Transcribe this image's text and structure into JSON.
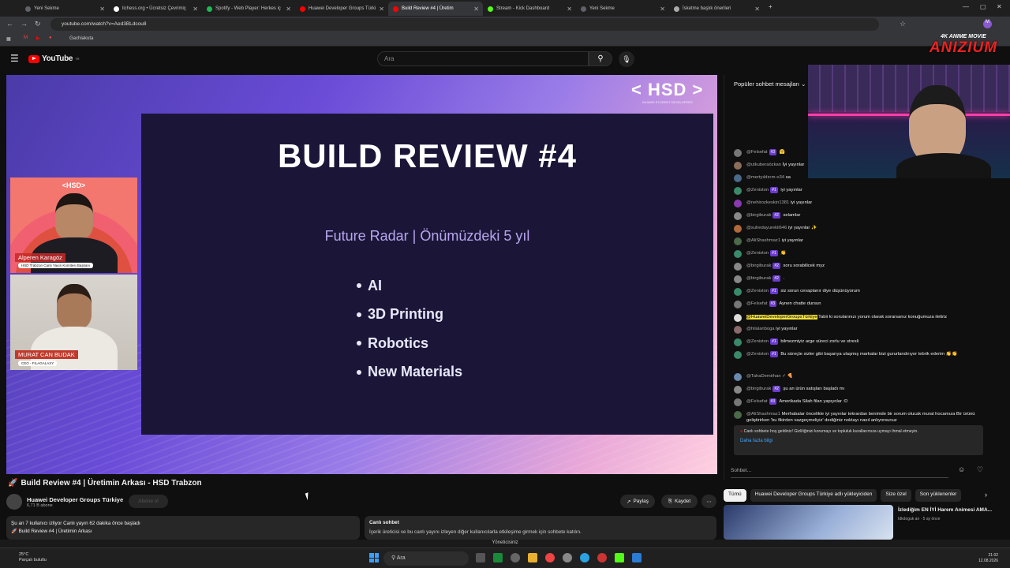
{
  "browser": {
    "tabs": [
      {
        "label": "Yeni Sekme",
        "fav": "#5f6368"
      },
      {
        "label": "lichess.org • Ücretsiz Çevrimiç",
        "fav": "#ffffff"
      },
      {
        "label": "Spotify - Web Player: Herkes iç",
        "fav": "#1db954"
      },
      {
        "label": "Huawei Developer Groups Türki",
        "fav": "#ff0000"
      },
      {
        "label": "Build Review #4 | Üretim",
        "fav": "#ff0000"
      },
      {
        "label": "Stream - Kick Dashboard",
        "fav": "#53fc18"
      },
      {
        "label": "Yeni Sekme",
        "fav": "#5f6368"
      },
      {
        "label": "İsketme başlık önerileri",
        "fav": "#aaaaaa"
      }
    ],
    "url": "youtube.com/watch?v=Aed3BLdcou8",
    "bookmark": "Gachiakuta"
  },
  "youtube": {
    "logo": "YouTube",
    "logo_country": "TR",
    "search_placeholder": "Ara",
    "search_icon": "search-icon",
    "mic_icon": "mic-icon"
  },
  "video": {
    "slide_title": "BUILD REVIEW #4",
    "slide_subtitle": "Future Radar | Önümüzdeki 5 yıl",
    "bullets": [
      "AI",
      "3D Printing",
      "Robotics",
      "New Materials"
    ],
    "hsd_logo": "< HSD >",
    "hsd_caption": "HUAWEI STUDENT DEVELOPERS",
    "cam1_logo": "<HSD>",
    "cam1_name": "Alperen Karagöz",
    "cam1_role": "HSD Trabzon Canlı Yayın Komitesi Başkanı",
    "cam2_name": "MURAT CAN BUDAK",
    "cam2_role": "CEO - FILAGALAXY"
  },
  "below": {
    "title": "Build Review #4 | Üretimin Arkası - HSD Trabzon",
    "channel": "Huawei Developer Groups Türkiye",
    "subs": "6,71 B abone",
    "subscribe": "Abone ol",
    "share": "Paylaş",
    "save": "Kaydet",
    "more": "⋯",
    "desc_line1": "Şu an 7 kullanıcı izliyor  Canlı yayın 62 dakika önce başladı",
    "desc_line2": "🚀 Build Review #4 | Üretimin Arkası",
    "live_chat_title": "Canlı sohbet",
    "live_chat_text": "İçerik üreticisi ve bu canlı yayını izleyen diğer kullanıcılarla etkileşime girmek için sohbete katılın."
  },
  "chat": {
    "header": "Popüler sohbet mesajları",
    "messages": [
      {
        "user": "@Felsefat",
        "badge": "#3",
        "text": "🤗",
        "color": "#777"
      },
      {
        "user": "@utkuberaözkan",
        "badge": "",
        "text": "İyi yayınlar",
        "color": "#8a6d5a"
      },
      {
        "user": "@mertyıldırım-o34",
        "badge": "",
        "text": "sa",
        "color": "#4a6a8a"
      },
      {
        "user": "@Zeniston",
        "badge": "#1",
        "text": "iyi yayınlar",
        "color": "#3a8a6a"
      },
      {
        "user": "@nehirozkeskin1381",
        "badge": "",
        "text": "iyi yayınlar",
        "color": "#8a3ab0"
      },
      {
        "user": "@birgiburak",
        "badge": "#2",
        "text": "selamlar",
        "color": "#888"
      },
      {
        "user": "@suhedayurekli646",
        "badge": "",
        "text": "iyi yayınlar ✨",
        "color": "#b06a3a"
      },
      {
        "user": "@AliShashmaz1",
        "badge": "",
        "text": "iyi yayınlar",
        "color": "#4a6a4a"
      },
      {
        "user": "@Zeniston",
        "badge": "#1",
        "text": "👏",
        "color": "#3a8a6a"
      },
      {
        "user": "@birgiburak",
        "badge": "#2",
        "text": "soru sorabilicek myz",
        "color": "#888"
      },
      {
        "user": "@birgiburak",
        "badge": "#2",
        "text": ".",
        "color": "#888"
      },
      {
        "user": "@Zeniston",
        "badge": "#1",
        "text": "siz sorun cevaplanır diye düşünüyorum",
        "color": "#3a8a6a"
      },
      {
        "user": "@Felsefat",
        "badge": "#3",
        "text": "Aynen chatte dursun",
        "color": "#777"
      },
      {
        "user": "@HuaweiDeveloperGroupsTürkiye",
        "badge": "",
        "text": "Tabii ki sorularınızı yorum olarak sorarsanız konuğumuza iletiriz",
        "color": "#ddd"
      },
      {
        "user": "@hilalariboga",
        "badge": "",
        "text": "iyi yayınlar",
        "color": "#8a6a6a"
      },
      {
        "user": "@Zeniston",
        "badge": "#1",
        "text": "bilmezmiyiz arge süreci zorlu ve stresli",
        "color": "#3a8a6a"
      },
      {
        "user": "@Zeniston",
        "badge": "#1",
        "text": "Bu süreçte sizler gibi başarıya ulaşmış markalar bizi gururlandırıyor tebrik ederim 👏👏",
        "color": "#3a8a6a"
      },
      {
        "user": "@TahaDemirhan ✓",
        "badge": "",
        "text": "🍕",
        "color": "#6a8ab0"
      },
      {
        "user": "@birgiburak",
        "badge": "#2",
        "text": "şu an ürün satışları başladı mı",
        "color": "#888"
      },
      {
        "user": "@Felsefat",
        "badge": "#3",
        "text": "Amerikada Silah filan yapıyolar :D",
        "color": "#777"
      },
      {
        "user": "@AliShashmaz1",
        "badge": "",
        "text": "Merhabalar öncelikle iyi yayınlar tekrardan benimde bir sorum olucak murat hocamıza Bir ürünü geliştirirken 'bu fikirden vazgeçmeliyiz' dediğiniz noktayı nasıl anlıyorsunuz",
        "color": "#4a6a4a"
      }
    ],
    "welcome": "Canlı sohbete hoş geldiniz! Gizliliğinizi korumayı ve topluluk kurallarımıza uymayı ihmal etmeyin.",
    "learn_more": "Daha fazla bilgi",
    "input_placeholder": "Sohbet..."
  },
  "reco": {
    "chips": [
      "Tümü",
      "Huawei Developer Groups Türkiye adlı yükleyiciden",
      "Size özel",
      "Son yüklenenler"
    ],
    "title": "İzlediğim EN İYİ Harem Animesi AMA...",
    "by": "Idkdoguk an · 5 ay önce"
  },
  "overlay": {
    "brand_top": "4K ANIME MOVIE",
    "brand": "ANIZIUM"
  },
  "system": {
    "manage": "Yöneticisiniz",
    "weather_temp": "25°C",
    "weather_desc": "Parçalı bulutlu",
    "taskbar_search": "Ara",
    "time": "21:02",
    "date": "12.08.2026"
  }
}
